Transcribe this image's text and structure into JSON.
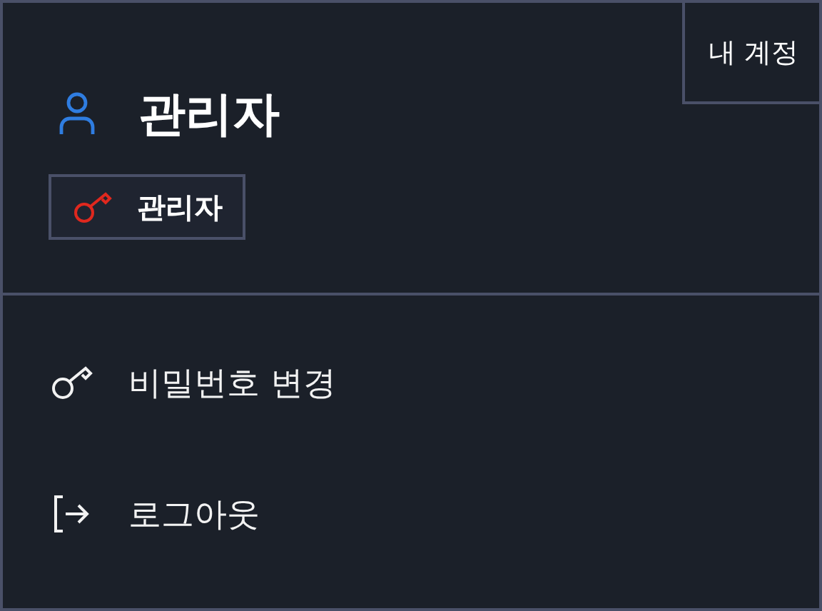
{
  "account_tab": {
    "label": "내 계정"
  },
  "user": {
    "name": "관리자",
    "role": "관리자"
  },
  "menu": [
    {
      "kind": "key",
      "label": "비밀번호 변경"
    },
    {
      "kind": "logout",
      "label": "로그아웃"
    }
  ]
}
